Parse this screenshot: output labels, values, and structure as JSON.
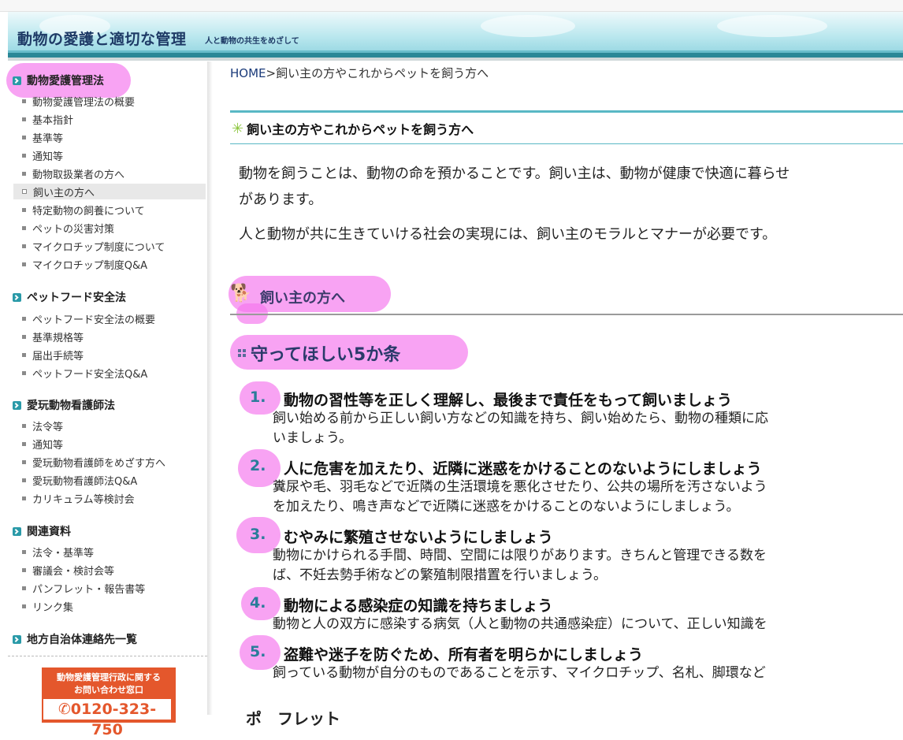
{
  "header": {
    "title": "動物の愛護と適切な管理",
    "subtitle": "人と動物の共生をめざして"
  },
  "sidebar": {
    "sections": [
      {
        "title": "動物愛護管理法",
        "items": [
          "動物愛護管理法の概要",
          "基本指針",
          "基準等",
          "通知等",
          "動物取扱業者の方へ",
          "飼い主の方へ",
          "特定動物の飼養について",
          "ペットの災害対策",
          "マイクロチップ制度について",
          "マイクロチップ制度Q&A"
        ]
      },
      {
        "title": "ペットフード安全法",
        "items": [
          "ペットフード安全法の概要",
          "基準規格等",
          "届出手続等",
          "ペットフード安全法Q&A"
        ]
      },
      {
        "title": "愛玩動物看護師法",
        "items": [
          "法令等",
          "通知等",
          "愛玩動物看護師をめざす方へ",
          "愛玩動物看護師法Q&A",
          "カリキュラム等検討会"
        ]
      },
      {
        "title": "関連資料",
        "items": [
          "法令・基準等",
          "審議会・検討会等",
          "パンフレット・報告書等",
          "リンク集"
        ]
      },
      {
        "title": "地方自治体連絡先一覧",
        "items": []
      }
    ],
    "active_item": "飼い主の方へ",
    "contact": {
      "line1": "動物愛護管理行政に関する",
      "line2": "お問い合わせ窓口",
      "phone": "0120-323-750"
    }
  },
  "breadcrumb": {
    "home": "HOME",
    "separator": ">",
    "current": "飼い主の方やこれからペットを飼う方へ"
  },
  "page": {
    "title": "飼い主の方やこれからペットを飼う方へ",
    "lead_line1": "動物を飼うことは、動物の命を預かることです。飼い主は、動物が健康で快適に暮らせ",
    "lead_line2": "があります。",
    "lead_line3": "人と動物が共に生きていける社会の実現には、飼い主のモラルとマナーが必要です。",
    "subheading": "飼い主の方へ",
    "section_heading": "守ってほしい5か条",
    "rules": [
      {
        "num": "1.",
        "head": "動物の習性等を正しく理解し、最後まで責任をもって飼いましょう",
        "body1": "飼い始める前から正しい飼い方などの知識を持ち、飼い始めたら、動物の種類に応",
        "body2": "いましょう。"
      },
      {
        "num": "2.",
        "head": "人に危害を加えたり、近隣に迷惑をかけることのないようにしましょう",
        "body1": "糞尿や毛、羽毛などで近隣の生活環境を悪化させたり、公共の場所を汚さないよう",
        "body2": "を加えたり、鳴き声などで近隣に迷惑をかけることのないようにしましょう。"
      },
      {
        "num": "3.",
        "head": "むやみに繁殖させないようにしましょう",
        "body1": "動物にかけられる手間、時間、空間には限りがあります。きちんと管理できる数を",
        "body2": "ば、不妊去勢手術などの繁殖制限措置を行いましょう。"
      },
      {
        "num": "4.",
        "head": "動物による感染症の知識を持ちましょう",
        "body1": "動物と人の双方に感染する病気（人と動物の共通感染症）について、正しい知識を",
        "body2": ""
      },
      {
        "num": "5.",
        "head": "盗難や迷子を防ぐため、所有者を明らかにしましょう",
        "body1": "飼っている動物が自分のものであることを示す、マイクロチップ、名札、脚環など",
        "body2": ""
      }
    ],
    "cut_heading": "ポ　フレット"
  }
}
